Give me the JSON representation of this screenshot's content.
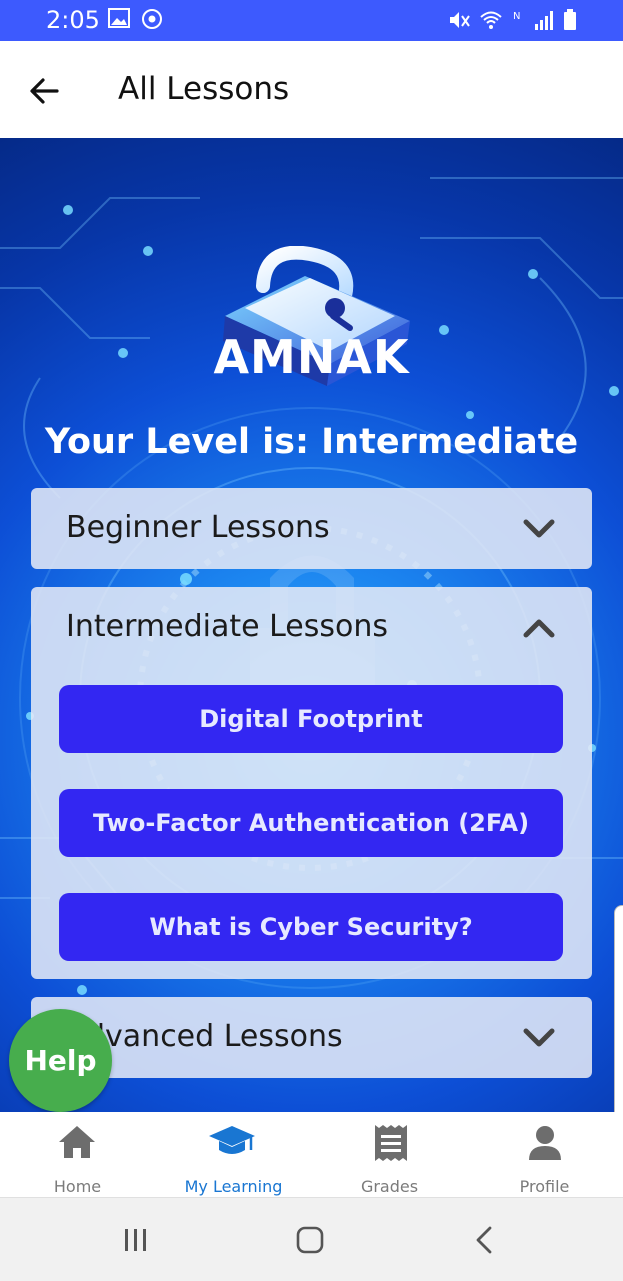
{
  "status_bar": {
    "time": "2:05",
    "color": "#3d5afe"
  },
  "app_bar": {
    "title": "All Lessons",
    "back_icon": "arrow-left-icon"
  },
  "logo": {
    "text": "AMNAK",
    "icon": "padlock-icon"
  },
  "level_text": "Your Level is: Intermediate",
  "sections": [
    {
      "label": "Beginner Lessons",
      "expanded": false,
      "icon": "chevron-down-icon"
    },
    {
      "label": "Intermediate Lessons",
      "expanded": true,
      "icon": "chevron-up-icon",
      "lessons": [
        "Digital Footprint",
        "Two-Factor Authentication (2FA)",
        "What is Cyber Security?"
      ]
    },
    {
      "label": "Advanced Lessons",
      "expanded": false,
      "icon": "chevron-down-icon"
    }
  ],
  "help_button": {
    "label": "Help",
    "color": "#47ad4d"
  },
  "bottom_nav": [
    {
      "label": "Home",
      "icon": "home-icon",
      "active": false
    },
    {
      "label": "My Learning",
      "icon": "graduation-cap-icon",
      "active": true
    },
    {
      "label": "Grades",
      "icon": "receipt-icon",
      "active": false
    },
    {
      "label": "Profile",
      "icon": "person-icon",
      "active": false
    }
  ],
  "colors": {
    "accent": "#1976d2",
    "lesson_button": "#3327f2",
    "background": "#0d4fd6"
  }
}
